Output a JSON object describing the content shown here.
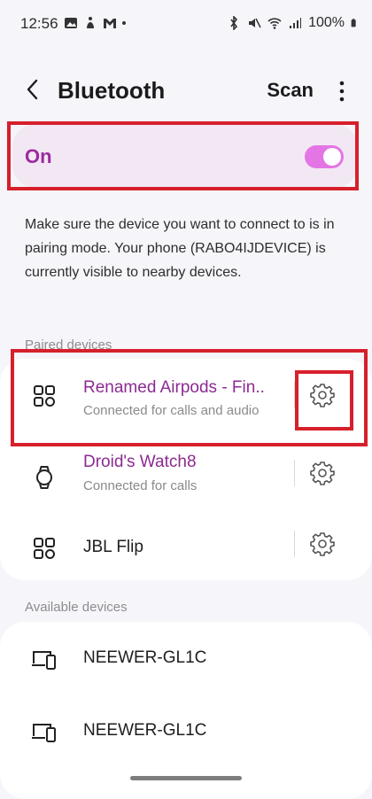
{
  "status_bar": {
    "time": "12:56",
    "battery": "100%"
  },
  "header": {
    "title": "Bluetooth",
    "scan_label": "Scan"
  },
  "toggle": {
    "label": "On",
    "state": "on",
    "accent_color": "#e376e4"
  },
  "description": "Make sure the device you want to connect to is in pairing mode. Your phone (RABO4IJDEVICE) is currently visible to nearby devices.",
  "paired": {
    "section_label": "Paired devices",
    "devices": [
      {
        "name": "Renamed Airpods - Fin..",
        "status": "Connected for calls and audio",
        "icon": "earbuds-icon"
      },
      {
        "name": "Droid's Watch8",
        "status": "Connected for calls",
        "icon": "watch-icon"
      },
      {
        "name": "JBL Flip",
        "status": "",
        "icon": "earbuds-icon"
      }
    ]
  },
  "available": {
    "section_label": "Available devices",
    "devices": [
      {
        "name": "NEEWER-GL1C",
        "icon": "devices-icon"
      },
      {
        "name": "NEEWER-GL1C",
        "icon": "devices-icon"
      }
    ]
  },
  "colors": {
    "highlight_outline": "#d6202c",
    "connected_name": "#8d2a92"
  }
}
